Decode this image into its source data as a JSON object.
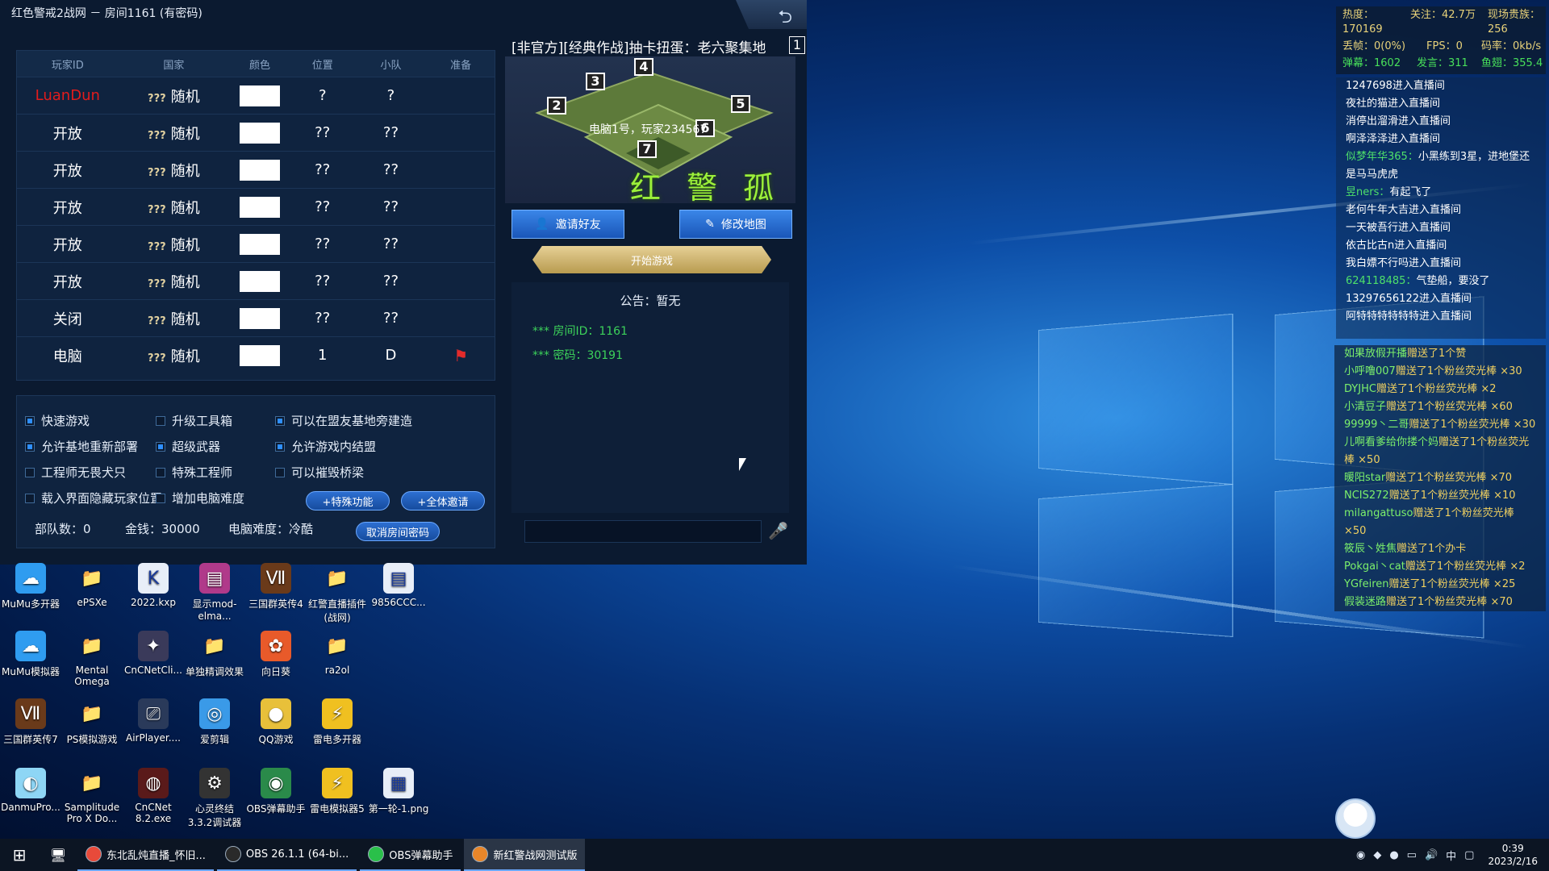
{
  "window": {
    "title": "红色警戒2战网 － 房间1161 (有密码)",
    "back_icon": "back-arrow-icon"
  },
  "players_table": {
    "headers": [
      "玩家ID",
      "国家",
      "颜色",
      "位置",
      "小队",
      "准备"
    ],
    "rows": [
      {
        "id": "LuanDun",
        "qq": "???",
        "country": "随机",
        "position": "?",
        "team": "?",
        "ready": ""
      },
      {
        "id": "开放",
        "qq": "???",
        "country": "随机",
        "position": "??",
        "team": "??",
        "ready": ""
      },
      {
        "id": "开放",
        "qq": "???",
        "country": "随机",
        "position": "??",
        "team": "??",
        "ready": ""
      },
      {
        "id": "开放",
        "qq": "???",
        "country": "随机",
        "position": "??",
        "team": "??",
        "ready": ""
      },
      {
        "id": "开放",
        "qq": "???",
        "country": "随机",
        "position": "??",
        "team": "??",
        "ready": ""
      },
      {
        "id": "开放",
        "qq": "???",
        "country": "随机",
        "position": "??",
        "team": "??",
        "ready": ""
      },
      {
        "id": "关闭",
        "qq": "???",
        "country": "随机",
        "position": "??",
        "team": "??",
        "ready": ""
      },
      {
        "id": "电脑",
        "qq": "???",
        "country": "随机",
        "position": "1",
        "team": "D",
        "ready": "flag"
      }
    ]
  },
  "options": {
    "quick_game": {
      "label": "快速游戏",
      "checked": true
    },
    "upgrade_crate": {
      "label": "升级工具箱",
      "checked": false
    },
    "build_near_ally": {
      "label": "可以在盟友基地旁建造",
      "checked": true
    },
    "redeploy_base": {
      "label": "允许基地重新部署",
      "checked": true
    },
    "super_weapons": {
      "label": "超级武器",
      "checked": true
    },
    "in_game_alliance": {
      "label": "允许游戏内结盟",
      "checked": true
    },
    "engineer_no_dogs": {
      "label": "工程师无畏犬只",
      "checked": false
    },
    "special_engineer": {
      "label": "特殊工程师",
      "checked": false
    },
    "destroy_bridges": {
      "label": "可以摧毁桥梁",
      "checked": false
    },
    "hide_positions": {
      "label": "载入界面隐藏玩家位置",
      "checked": false
    },
    "ai_difficulty_up": {
      "label": "增加电脑难度",
      "checked": false
    },
    "special_features_btn": "+特殊功能",
    "invite_all_btn": "+全体邀请",
    "units": "部队数：0",
    "money": "金钱：30000",
    "ai_level": "电脑难度：冷酷",
    "cancel_password_btn": "取消房间密码"
  },
  "map": {
    "header": "[非官方][经典作战]抽卡扭蛋：老六聚集地",
    "header_badge": "1",
    "spawns": [
      "4",
      "3",
      "2",
      "5",
      "6",
      "7"
    ],
    "label": "电脑1号，玩家234567",
    "watermark": "红 警 孤 叶"
  },
  "room": {
    "invite_btn": "邀请好友",
    "edit_map_btn": "修改地图",
    "start_btn": "开始游戏",
    "notice": "公告：暂无",
    "room_id": "*** 房间ID：1161",
    "password": "*** 密码：30191"
  },
  "stream_stats": {
    "heat": "热度：170169",
    "follow": "关注：42.7万",
    "vip": "现场贵族：256",
    "drop": "丢帧：0(0%)",
    "fps": "FPS：0",
    "bitrate": "码率：0kb/s",
    "danmu": "弹幕：1602",
    "speak": "发言：311",
    "fish": "鱼翅：355.4"
  },
  "feed": [
    {
      "user": "",
      "text": "1247698进入直播间"
    },
    {
      "user": "",
      "text": "夜社的猫进入直播间"
    },
    {
      "user": "",
      "text": "消停出溜滑进入直播间"
    },
    {
      "user": "",
      "text": "啊泽泽泽进入直播间"
    },
    {
      "user": "似梦年华365：",
      "text": "小黑练到3星，进地堡还是马马虎虎"
    },
    {
      "user": "昱ners：",
      "text": "有起飞了"
    },
    {
      "user": "",
      "text": "老何牛年大吉进入直播间"
    },
    {
      "user": "",
      "text": "一天被吾行进入直播间"
    },
    {
      "user": "",
      "text": "依古比古n进入直播间"
    },
    {
      "user": "",
      "text": "我白嫖不行吗进入直播间"
    },
    {
      "user": "624118485：",
      "text": "气垫船，要没了"
    },
    {
      "user": "",
      "text": "13297656122进入直播间"
    },
    {
      "user": "",
      "text": "阿特特特特特特进入直播间"
    }
  ],
  "gifts": [
    {
      "user": "如果放假开播",
      "text": "赠送了1个赞",
      "count": ""
    },
    {
      "user": "小呼噜007",
      "text": "赠送了1个粉丝荧光棒",
      "count": "×30"
    },
    {
      "user": "DYJHC",
      "text": "赠送了1个粉丝荧光棒",
      "count": "×2"
    },
    {
      "user": "小清豆子",
      "text": "赠送了1个粉丝荧光棒",
      "count": "×60"
    },
    {
      "user": "99999丶二哥",
      "text": "赠送了1个粉丝荧光棒",
      "count": "×30"
    },
    {
      "user": "儿啊看爹给你搂个妈",
      "text": "赠送了1个粉丝荧光棒",
      "count": "×50"
    },
    {
      "user": "暖阳star",
      "text": "赠送了1个粉丝荧光棒",
      "count": "×70"
    },
    {
      "user": "NCIS272",
      "text": "赠送了1个粉丝荧光棒",
      "count": "×10"
    },
    {
      "user": "milangattuso",
      "text": "赠送了1个粉丝荧光棒",
      "count": "×50"
    },
    {
      "user": "筱辰丶姓焦",
      "text": "赠送了1个办卡",
      "count": ""
    },
    {
      "user": "Pokgai丶cat",
      "text": "赠送了1个粉丝荧光棒",
      "count": "×2"
    },
    {
      "user": "YGfeiren",
      "text": "赠送了1个粉丝荧光棒",
      "count": "×25"
    },
    {
      "user": "假装迷路",
      "text": "赠送了1个粉丝荧光棒",
      "count": "×70"
    }
  ],
  "desktop_icons": [
    {
      "label": "MuMu多开器",
      "icon": "mumu-icon"
    },
    {
      "label": "ePSXe",
      "icon": "folder-icon"
    },
    {
      "label": "2022.kxp",
      "icon": "kxp-file-icon"
    },
    {
      "label": "显示mod-elma...",
      "icon": "winrar-icon"
    },
    {
      "label": "三国群英传4",
      "icon": "game-icon"
    },
    {
      "label": "红警直播插件(战网)",
      "icon": "folder-icon"
    },
    {
      "label": "9856CCC...",
      "icon": "file-icon"
    },
    {
      "label": "MuMu模拟器",
      "icon": "mumu-icon"
    },
    {
      "label": "Mental Omega",
      "icon": "folder-icon"
    },
    {
      "label": "CnCNetCli...",
      "icon": "cncnet-icon"
    },
    {
      "label": "单独精调效果",
      "icon": "folder-icon"
    },
    {
      "label": "向日葵",
      "icon": "sunlogin-icon"
    },
    {
      "label": "ra2ol",
      "icon": "folder-icon"
    },
    {
      "label": "三国群英传7",
      "icon": "game-icon"
    },
    {
      "label": "PS模拟游戏",
      "icon": "folder-icon"
    },
    {
      "label": "AirPlayer....",
      "icon": "airplay-icon"
    },
    {
      "label": "爱剪辑",
      "icon": "editor-icon"
    },
    {
      "label": "QQ游戏",
      "icon": "qq-game-icon"
    },
    {
      "label": "雷电多开器",
      "icon": "leidian-icon"
    },
    {
      "label": "DanmuPro...",
      "icon": "danmu-icon"
    },
    {
      "label": "Samplitude Pro X Do...",
      "icon": "folder-icon"
    },
    {
      "label": "CnCNet 8.2.exe",
      "icon": "cncnet-exe-icon"
    },
    {
      "label": "心灵终结3.3.2调试器",
      "icon": "debugger-icon"
    },
    {
      "label": "OBS弹幕助手",
      "icon": "obs-icon"
    },
    {
      "label": "雷电模拟器5",
      "icon": "leidian-icon"
    },
    {
      "label": "第一轮-1.png",
      "icon": "image-file-icon"
    }
  ],
  "taskbar": {
    "items": [
      {
        "label": "东北乱炖直播_怀旧...",
        "icon": "chrome-icon",
        "active": false
      },
      {
        "label": "OBS 26.1.1 (64-bi...",
        "icon": "obs-icon",
        "active": false
      },
      {
        "label": "OBS弹幕助手",
        "icon": "obs-danmu-icon",
        "active": false
      },
      {
        "label": "新红警战网测试版",
        "icon": "ra2-icon",
        "active": true
      }
    ],
    "ime": "中",
    "time": "0:39",
    "date": "2023/2/16"
  }
}
